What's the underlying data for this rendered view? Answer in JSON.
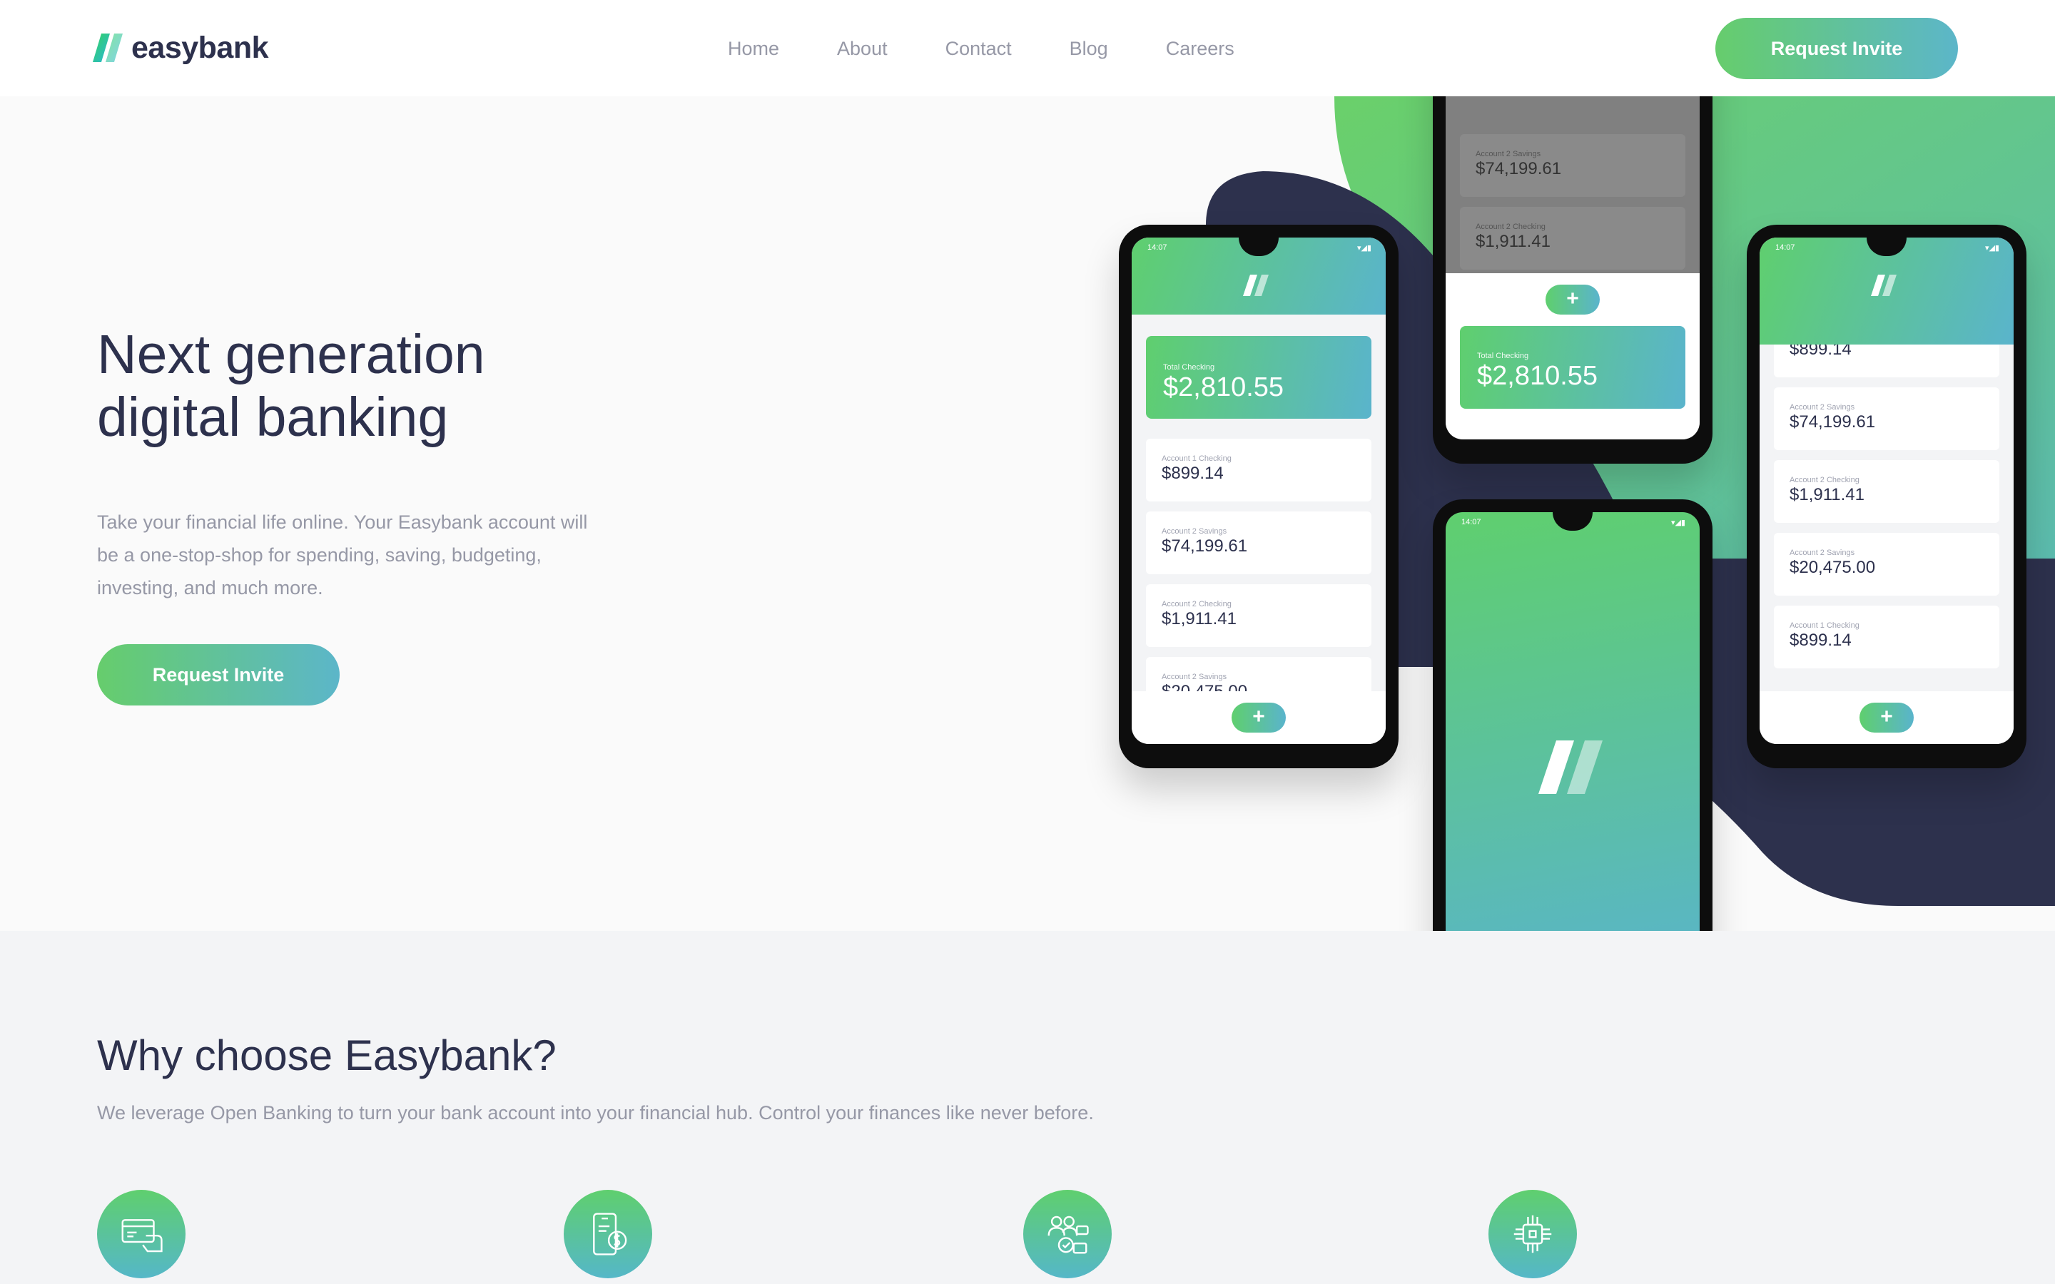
{
  "brand": {
    "name": "easybank"
  },
  "nav": {
    "links": [
      "Home",
      "About",
      "Contact",
      "Blog",
      "Careers"
    ],
    "cta_label": "Request Invite"
  },
  "hero": {
    "title": "Next generation digital banking",
    "description": "Take your financial life online. Your Easybank account will be a one-stop-shop for spending, saving, budgeting, investing, and much more.",
    "cta_label": "Request Invite"
  },
  "phones": {
    "status_time": "14:07",
    "total_label": "Total Checking",
    "total_value": "$2,810.55",
    "accounts": [
      {
        "label": "Account 1 Checking",
        "value": "$899.14"
      },
      {
        "label": "Account 2 Savings",
        "value": "$74,199.61"
      },
      {
        "label": "Account 2 Checking",
        "value": "$1,911.41"
      },
      {
        "label": "Account 2 Savings",
        "value": "$20,475.00"
      },
      {
        "label": "Account 1 Checking",
        "value": "$899.14"
      }
    ]
  },
  "features": {
    "title": "Why choose Easybank?",
    "description": "We leverage Open Banking to turn your bank account into your financial hub. Control your finances like never before.",
    "icons": [
      "online-banking-icon",
      "simple-budgeting-icon",
      "fast-onboarding-icon",
      "open-api-icon"
    ]
  },
  "colors": {
    "dark_blue": "#2d314d",
    "grayish_blue": "#9698a6",
    "lime_green": "#31d35c",
    "bright_cyan": "#2bb7da",
    "light_bg": "#fafafa"
  }
}
